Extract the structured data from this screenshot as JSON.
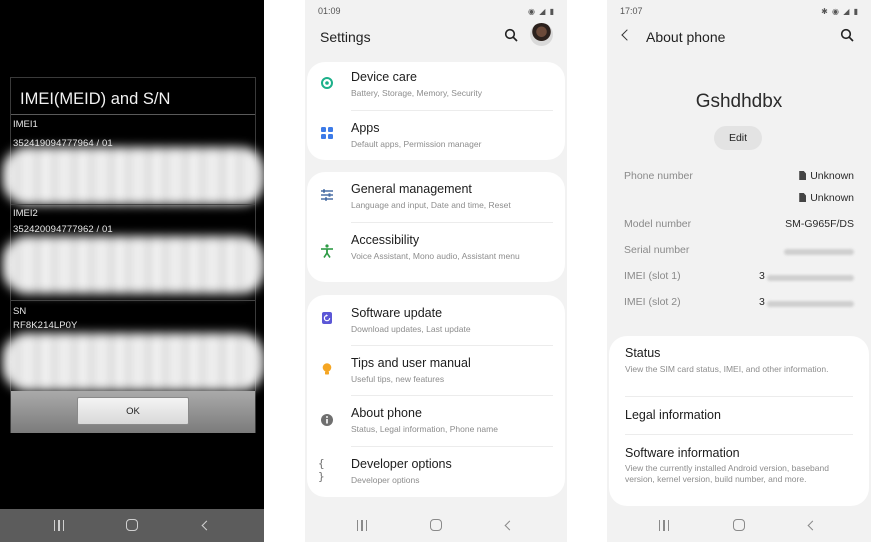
{
  "imei_dialog": {
    "title": "IMEI(MEID) and S/N",
    "rows": [
      {
        "label": "IMEI1",
        "value": "352419094777964 / 01"
      },
      {
        "label": "IMEI2",
        "value": "352420094777962 / 01"
      },
      {
        "label": "SN",
        "value": "RF8K214LP0Y"
      }
    ],
    "ok_label": "OK"
  },
  "settings": {
    "status_time": "01:09",
    "title": "Settings",
    "items": [
      {
        "title": "Device care",
        "subtitle": "Battery, Storage, Memory, Security",
        "icon": "device-care-icon",
        "color": "#1db08a"
      },
      {
        "title": "Apps",
        "subtitle": "Default apps, Permission manager",
        "icon": "apps-icon",
        "color": "#3d7be8"
      },
      {
        "title": "General management",
        "subtitle": "Language and input, Date and time, Reset",
        "icon": "sliders-icon",
        "color": "#4a6fa5"
      },
      {
        "title": "Accessibility",
        "subtitle": "Voice Assistant, Mono audio, Assistant menu",
        "icon": "accessibility-icon",
        "color": "#2e9b45"
      },
      {
        "title": "Software update",
        "subtitle": "Download updates, Last update",
        "icon": "software-update-icon",
        "color": "#5b57d6"
      },
      {
        "title": "Tips and user manual",
        "subtitle": "Useful tips, new features",
        "icon": "lightbulb-icon",
        "color": "#f5a623"
      },
      {
        "title": "About phone",
        "subtitle": "Status, Legal information, Phone name",
        "icon": "info-icon",
        "color": "#6f6f6f"
      },
      {
        "title": "Developer options",
        "subtitle": "Developer options",
        "icon": "braces-icon",
        "color": "#6f6f6f"
      }
    ]
  },
  "about": {
    "status_time": "17:07",
    "title": "About phone",
    "device_name": "Gshdhdbx",
    "edit_label": "Edit",
    "phone_number_label": "Phone number",
    "phone_number_1": "Unknown",
    "phone_number_2": "Unknown",
    "model_label": "Model number",
    "model_value": "SM-G965F/DS",
    "serial_label": "Serial number",
    "imei1_label": "IMEI (slot 1)",
    "imei1_prefix": "3",
    "imei2_label": "IMEI (slot 2)",
    "imei2_prefix": "3",
    "sections": [
      {
        "title": "Status",
        "subtitle": "View the SIM card status, IMEI, and other information."
      },
      {
        "title": "Legal information",
        "subtitle": ""
      },
      {
        "title": "Software information",
        "subtitle": "View the currently installed Android version, baseband version, kernel version, build number, and more."
      }
    ]
  }
}
